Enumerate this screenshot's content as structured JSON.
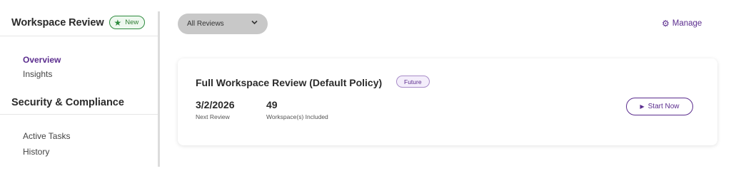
{
  "sidebar": {
    "title": "Workspace Review",
    "new_badge": "New",
    "nav": [
      {
        "label": "Overview",
        "active": true
      },
      {
        "label": "Insights",
        "active": false
      }
    ],
    "section_title": "Security & Compliance",
    "section_items": [
      {
        "label": "Active Tasks"
      },
      {
        "label": "History"
      }
    ]
  },
  "toolbar": {
    "filter_value": "All Reviews",
    "manage_label": "Manage"
  },
  "card": {
    "title": "Full Workspace Review (Default Policy)",
    "status_badge": "Future",
    "next_review_value": "3/2/2026",
    "next_review_label": "Next Review",
    "workspaces_value": "49",
    "workspaces_label": "Workspace(s) Included",
    "start_label": "Start Now"
  },
  "colors": {
    "accent": "#5b2d8e",
    "new_badge_green": "#2e8b3e",
    "filter_bg": "#c8c8c8"
  },
  "icons": {
    "new_badge": "star-icon",
    "filter": "chevron-down-icon",
    "manage": "gear-icon",
    "start": "play-icon"
  }
}
